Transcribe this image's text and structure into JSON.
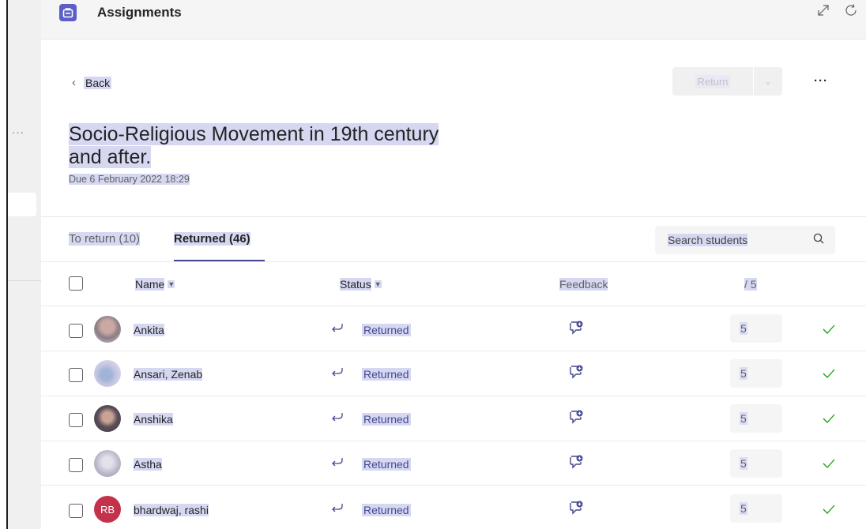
{
  "app": {
    "title": "Assignments"
  },
  "nav": {
    "back_label": "Back",
    "return_label": "Return"
  },
  "assignment": {
    "title": "Socio-Religious Movement in 19th century and after.",
    "due": "Due 6 February 2022 18:29"
  },
  "tabs": [
    {
      "label": "To return (10)",
      "active": false
    },
    {
      "label": "Returned (46)",
      "active": true
    }
  ],
  "search": {
    "placeholder": "Search students"
  },
  "columns": {
    "name": "Name",
    "status": "Status",
    "feedback": "Feedback",
    "points": "/ 5"
  },
  "students": [
    {
      "name": "Ankita",
      "status": "Returned",
      "score": "5"
    },
    {
      "name": "Ansari, Zenab",
      "status": "Returned",
      "score": "5"
    },
    {
      "name": "Anshika",
      "status": "Returned",
      "score": "5"
    },
    {
      "name": "Astha",
      "status": "Returned",
      "score": "5"
    },
    {
      "name": "bhardwaj, rashi",
      "status": "Returned",
      "score": "5",
      "initials": "RB"
    }
  ],
  "colors": {
    "accent": "#5b5fc7",
    "status": "#444791",
    "check": "#13a10e",
    "avatar_rb": "#c4314b"
  }
}
